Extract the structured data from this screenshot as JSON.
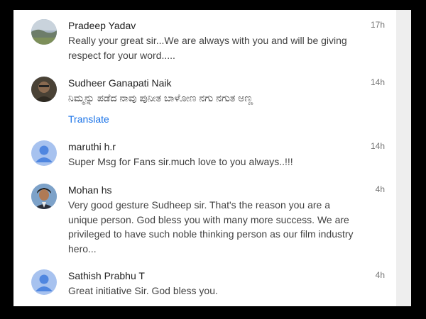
{
  "comments": [
    {
      "author": "Pradeep Yadav",
      "time": "17h",
      "text": "Really your great sir...We are always with you and will be giving respect for your word.....",
      "avatar": "photo-avatar-landscape"
    },
    {
      "author": "Sudheer Ganapati Naik",
      "time": "14h",
      "text": "ನಿಮ್ಮನ್ನು ಪಡೆದ ನಾವು ಪುನೀತ ಬಾಳೋಣ ನಗು ನಗುತ ಅಣ್ಣ",
      "translate_label": "Translate",
      "avatar": "photo-avatar-person"
    },
    {
      "author": "maruthi h.r",
      "time": "14h",
      "text": "Super Msg for Fans sir.much love to you always..!!!",
      "avatar": "default-user-icon"
    },
    {
      "author": "Mohan hs",
      "time": "4h",
      "text": "Very good gesture Sudheep sir. That's the reason you are a unique person. God bless  you with many more success. We are privileged to have such noble thinking person as our film industry hero...",
      "avatar": "photo-avatar-person-suit"
    },
    {
      "author": "Sathish Prabhu T",
      "time": "4h",
      "text": "Great initiative Sir. God bless you.",
      "avatar": "default-user-icon"
    }
  ],
  "colors": {
    "link": "#1a73e8",
    "default_avatar_bg": "#a7c2ef",
    "default_avatar_fg": "#4f86e0"
  }
}
